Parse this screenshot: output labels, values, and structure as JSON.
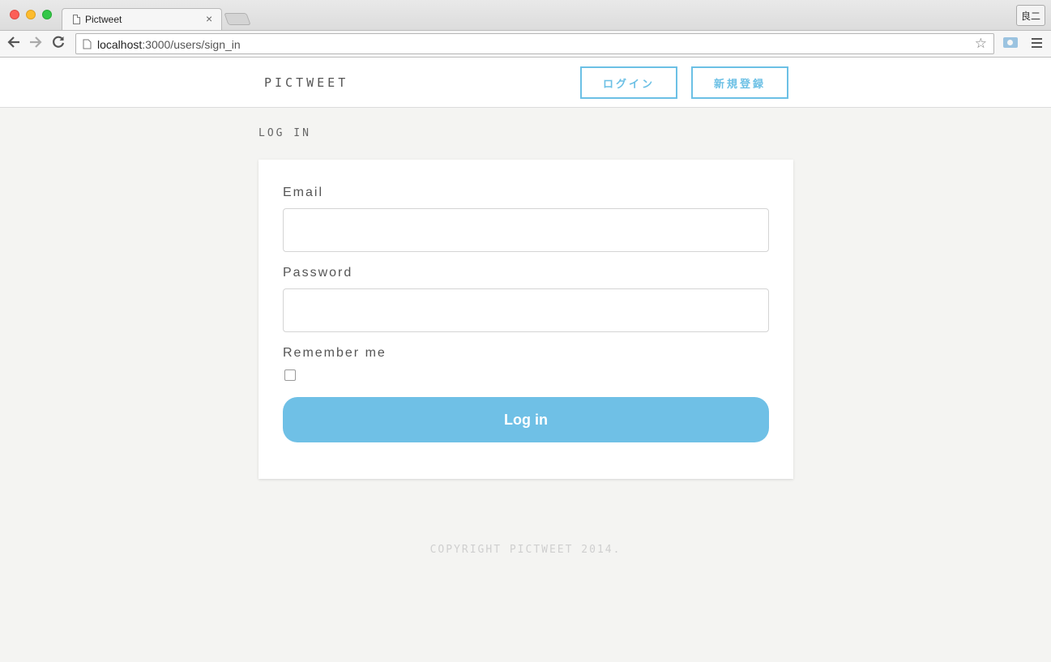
{
  "browser": {
    "tab_title": "Pictweet",
    "tab_close": "×",
    "url_host": "localhost",
    "url_rest": ":3000/users/sign_in",
    "profile_label": "良二",
    "icons": {
      "back": "back-arrow-icon",
      "forward": "forward-arrow-icon",
      "reload": "reload-icon",
      "bookmark": "star-icon",
      "camera": "camera-icon",
      "menu": "hamburger-menu-icon"
    }
  },
  "header": {
    "logo": "PICTWEET",
    "login_button": "ログイン",
    "signup_button": "新規登録"
  },
  "page": {
    "title": "LOG IN"
  },
  "form": {
    "email_label": "Email",
    "email_value": "",
    "password_label": "Password",
    "password_value": "",
    "remember_label": "Remember me",
    "remember_checked": false,
    "submit_label": "Log in"
  },
  "footer": {
    "copyright": "COPYRIGHT PICTWEET 2014."
  },
  "colors": {
    "accent": "#6cc0e5",
    "button_fill": "#6fc0e6",
    "background": "#f4f4f2"
  }
}
